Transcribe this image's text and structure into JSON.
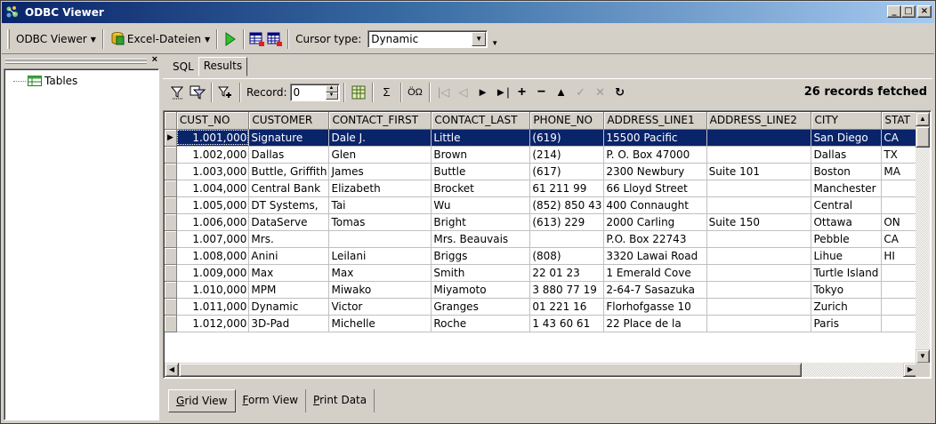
{
  "window": {
    "title": "ODBC Viewer"
  },
  "toolbar": {
    "app_menu": "ODBC Viewer",
    "source_menu": "Excel-Dateien",
    "cursor_label": "Cursor type:",
    "cursor_value": "Dynamic"
  },
  "left_pane": {
    "tree_root": "Tables"
  },
  "tabs_top": [
    "SQL",
    "Results"
  ],
  "results_toolbar": {
    "record_label": "Record:",
    "record_value": "0",
    "sigma": "Σ",
    "omega": "ÖΩ",
    "status": "26 records fetched"
  },
  "grid": {
    "columns": [
      "CUST_NO",
      "CUSTOMER",
      "CONTACT_FIRST",
      "CONTACT_LAST",
      "PHONE_NO",
      "ADDRESS_LINE1",
      "ADDRESS_LINE2",
      "CITY",
      "STAT"
    ],
    "rows": [
      [
        "1.001,000",
        "Signature",
        "Dale J.",
        "Little",
        "(619)",
        "15500 Pacific",
        "",
        "San Diego",
        "CA"
      ],
      [
        "1.002,000",
        "Dallas",
        "Glen",
        "Brown",
        "(214)",
        "P. O. Box 47000",
        "",
        "Dallas",
        "TX"
      ],
      [
        "1.003,000",
        "Buttle, Griffith",
        "James",
        "Buttle",
        "(617)",
        "2300 Newbury",
        "Suite 101",
        "Boston",
        "MA"
      ],
      [
        "1.004,000",
        "Central Bank",
        "Elizabeth",
        "Brocket",
        "61 211 99",
        "66 Lloyd Street",
        "",
        "Manchester",
        ""
      ],
      [
        "1.005,000",
        "DT Systems,",
        "Tai",
        "Wu",
        "(852) 850 43",
        "400 Connaught",
        "",
        "Central",
        ""
      ],
      [
        "1.006,000",
        "DataServe",
        "Tomas",
        "Bright",
        "(613) 229",
        "2000 Carling",
        "Suite 150",
        "Ottawa",
        "ON"
      ],
      [
        "1.007,000",
        "Mrs.",
        "",
        "Mrs. Beauvais",
        "",
        "P.O. Box 22743",
        "",
        "Pebble",
        "CA"
      ],
      [
        "1.008,000",
        "Anini",
        "Leilani",
        "Briggs",
        "(808)",
        "3320 Lawai Road",
        "",
        "Lihue",
        "HI"
      ],
      [
        "1.009,000",
        "Max",
        "Max",
        "Smith",
        "22 01 23",
        "1 Emerald Cove",
        "",
        "Turtle Island",
        ""
      ],
      [
        "1.010,000",
        "MPM",
        "Miwako",
        "Miyamoto",
        "3 880 77 19",
        "2-64-7 Sasazuka",
        "",
        "Tokyo",
        ""
      ],
      [
        "1.011,000",
        "Dynamic",
        "Victor",
        "Granges",
        "01 221 16",
        "Florhofgasse 10",
        "",
        "Zurich",
        ""
      ],
      [
        "1.012,000",
        "3D-Pad",
        "Michelle",
        "Roche",
        "1 43 60 61",
        "22 Place de la",
        "",
        "Paris",
        ""
      ]
    ]
  },
  "bottom_tabs": [
    {
      "accel": "G",
      "rest": "rid View"
    },
    {
      "accel": "F",
      "rest": "orm View"
    },
    {
      "accel": "P",
      "rest": "rint Data"
    }
  ]
}
